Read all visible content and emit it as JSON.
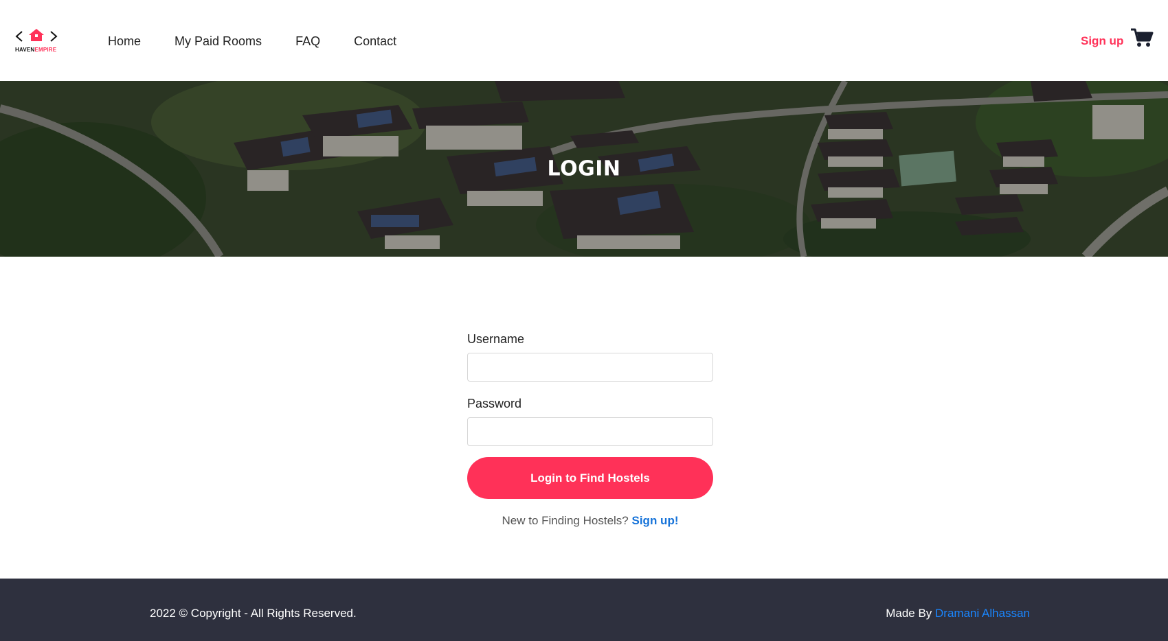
{
  "brand": {
    "name_part1": "HAVEN",
    "name_part2": "EMPIRE"
  },
  "nav": {
    "items": [
      "Home",
      "My Paid Rooms",
      "FAQ",
      "Contact"
    ]
  },
  "header": {
    "signup_label": "Sign up",
    "cart_icon": "shopping-cart-icon"
  },
  "hero": {
    "title": "LOGIN"
  },
  "form": {
    "username_label": "Username",
    "username_value": "",
    "password_label": "Password",
    "password_value": "",
    "submit_label": "Login to Find Hostels",
    "new_user_text": "New to Finding Hostels?",
    "new_user_link": "Sign up!"
  },
  "footer": {
    "copyright": "2022 © Copyright - All Rights Reserved.",
    "made_by_label": "Made By",
    "author": "Dramani Alhassan"
  },
  "colors": {
    "accent": "#ff3158",
    "link": "#1673d9",
    "footer_bg": "#2e303e"
  }
}
